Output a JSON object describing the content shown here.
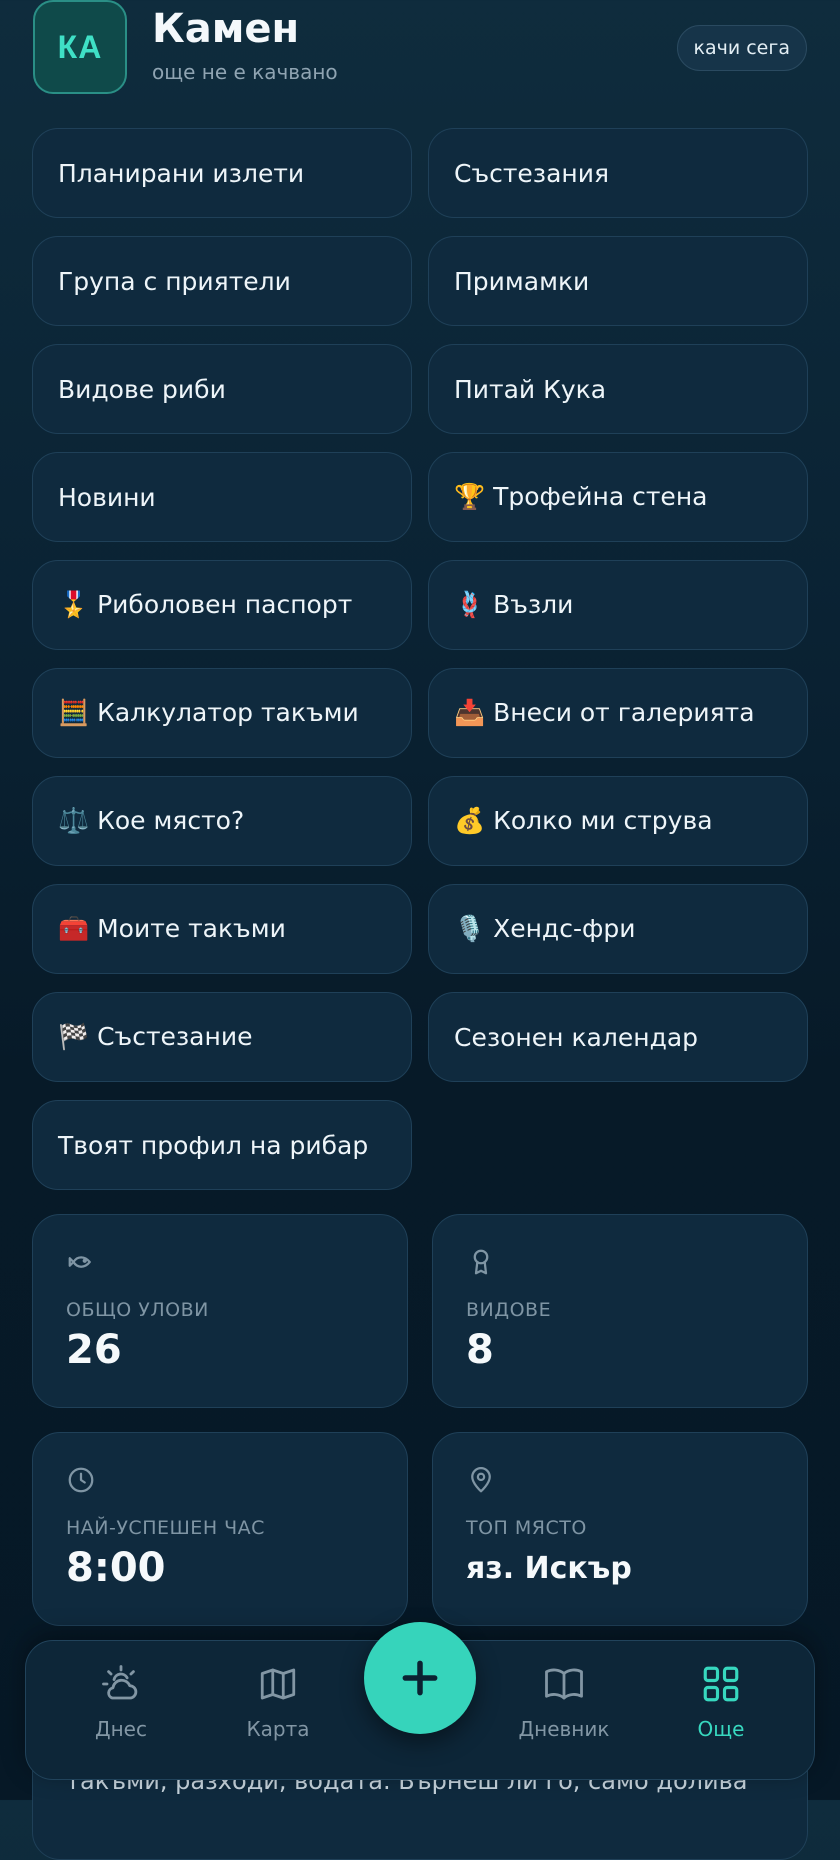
{
  "header": {
    "avatar_initials": "КА",
    "name": "Камен",
    "status": "още не е качвано",
    "upload_label": "качи сега"
  },
  "menu": [
    {
      "label": "Планирани излети",
      "icon": ""
    },
    {
      "label": "Състезания",
      "icon": ""
    },
    {
      "label": "Група с приятели",
      "icon": ""
    },
    {
      "label": "Примамки",
      "icon": ""
    },
    {
      "label": "Видове риби",
      "icon": ""
    },
    {
      "label": "Питай Кука",
      "icon": ""
    },
    {
      "label": "Новини",
      "icon": ""
    },
    {
      "label": "🏆 Трофейна стена",
      "icon": "trophy-icon"
    },
    {
      "label": "🎖️ Риболовен паспорт",
      "icon": "medal-icon"
    },
    {
      "label": "🪢 Възли",
      "icon": "knot-icon"
    },
    {
      "label": "🧮 Калкулатор такъми",
      "icon": "abacus-icon"
    },
    {
      "label": "📥 Внеси от галерията",
      "icon": "inbox-tray-icon"
    },
    {
      "label": "⚖️ Кое място?",
      "icon": "scales-icon"
    },
    {
      "label": "💰 Колко ми струва",
      "icon": "money-bag-icon"
    },
    {
      "label": "🧰 Моите такъми",
      "icon": "toolbox-icon"
    },
    {
      "label": "🎙️ Хендс-фри",
      "icon": "microphone-icon"
    },
    {
      "label": "🏁 Състезание",
      "icon": "checkered-flag-icon"
    },
    {
      "label": "Сезонен календар",
      "icon": ""
    },
    {
      "label": "Твоят профил на рибар",
      "icon": ""
    }
  ],
  "stats": {
    "total": {
      "label": "ОБЩО УЛОВИ",
      "value": "26",
      "icon": "fish-icon"
    },
    "species": {
      "label": "ВИДОВЕ",
      "value": "8",
      "icon": "award-icon"
    },
    "best_hour": {
      "label": "НАЙ-УСПЕШЕН ЧАС",
      "value": "8:00",
      "icon": "clock-icon"
    },
    "top_spot": {
      "label": "ТОП МЯСТО",
      "value": "яз. Искър",
      "icon": "map-pin-icon"
    }
  },
  "peek_text": "такъми, разходи, водата. Върнеш ли го, само долива",
  "nav": {
    "today": {
      "label": "Днес",
      "icon": "weather-icon"
    },
    "map": {
      "label": "Карта",
      "icon": "map-icon"
    },
    "add": {
      "label": "",
      "icon": "plus-icon"
    },
    "journal": {
      "label": "Дневник",
      "icon": "book-icon"
    },
    "more": {
      "label": "Още",
      "icon": "grid-icon",
      "active": true
    }
  },
  "colors": {
    "accent": "#36d4bb",
    "card_bg": "#0f2a3e",
    "card_border": "#1f4058",
    "muted_text": "#8296a4"
  }
}
